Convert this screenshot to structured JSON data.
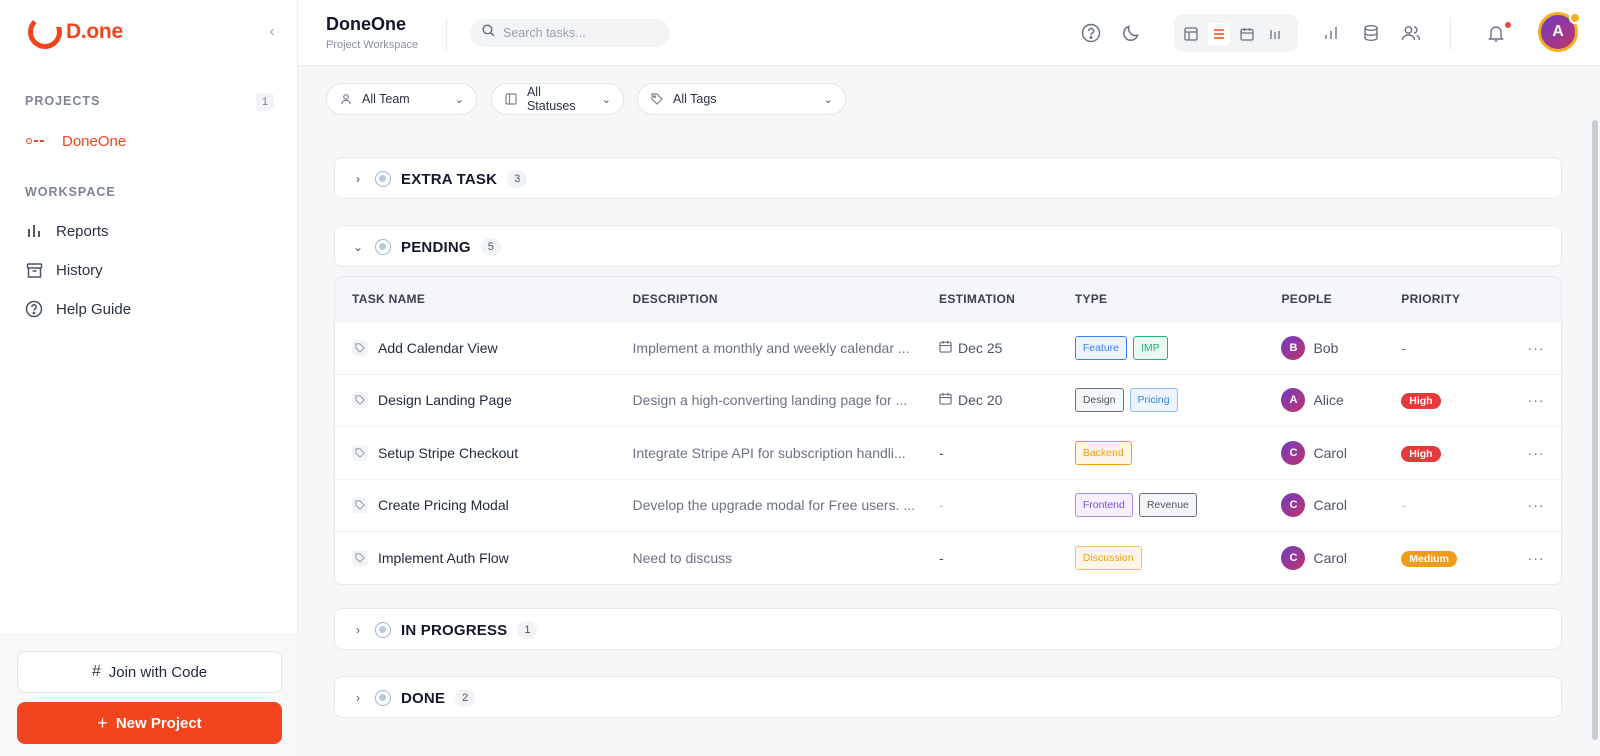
{
  "sidebar": {
    "brand": "D.one",
    "projects_label": "PROJECTS",
    "projects_count": "1",
    "project_name": "DoneOne",
    "workspace_label": "WORKSPACE",
    "nav": [
      {
        "label": "Reports",
        "icon": "bar-chart-icon"
      },
      {
        "label": "History",
        "icon": "archive-icon"
      },
      {
        "label": "Help Guide",
        "icon": "help-circle-icon"
      }
    ],
    "join_label": "Join with Code",
    "new_label": "New Project"
  },
  "header": {
    "title": "DoneOne",
    "subtitle": "Project Workspace",
    "search_placeholder": "Search tasks...",
    "avatar_initial": "A"
  },
  "filters": [
    {
      "label": "All Team",
      "icon": "user-icon"
    },
    {
      "label": "All Statuses",
      "icon": "columns-icon"
    },
    {
      "label": "All Tags",
      "icon": "tag-icon"
    }
  ],
  "groups": {
    "extra": {
      "name": "EXTRA TASK",
      "count": "3"
    },
    "pending": {
      "name": "PENDING",
      "count": "5"
    },
    "in_progress": {
      "name": "IN PROGRESS",
      "count": "1"
    },
    "done": {
      "name": "DONE",
      "count": "2"
    }
  },
  "table": {
    "headers": [
      "TASK NAME",
      "DESCRIPTION",
      "ESTIMATION",
      "TYPE",
      "PEOPLE",
      "PRIORITY"
    ],
    "rows": [
      {
        "name": "Add Calendar View",
        "desc": "Implement a monthly and weekly calendar ...",
        "est": "Dec 25",
        "tags": [
          "Feature",
          "IMP"
        ],
        "person": "Bob",
        "initial": "B",
        "priority": "-"
      },
      {
        "name": "Design Landing Page",
        "desc": "Design a high-converting landing page for ...",
        "est": "Dec 20",
        "tags": [
          "Design",
          "Pricing"
        ],
        "person": "Alice",
        "initial": "A",
        "priority": "High"
      },
      {
        "name": "Setup Stripe Checkout",
        "desc": "Integrate Stripe API for subscription handli...",
        "est": "-",
        "tags": [
          "Backend"
        ],
        "person": "Carol",
        "initial": "C",
        "priority": "High"
      },
      {
        "name": "Create Pricing Modal",
        "desc": "Develop the upgrade modal for Free users. ...",
        "est": "-",
        "tags": [
          "Frontend",
          "Revenue"
        ],
        "person": "Carol",
        "initial": "C",
        "priority": "-"
      },
      {
        "name": "Implement Auth Flow",
        "desc": "Need to discuss",
        "est": "-",
        "tags": [
          "Discussion"
        ],
        "person": "Carol",
        "initial": "C",
        "priority": "Medium"
      }
    ]
  },
  "colors": {
    "accent": "#f0451d",
    "high": "#e63939",
    "medium": "#f29b16",
    "tag_feature": "#3b82f6",
    "tag_imp": "#22b573",
    "tag_design": "#4b5563",
    "tag_pricing": "#3b82f6",
    "tag_backend": "#f29b16",
    "tag_frontend": "#7c4ddb",
    "tag_revenue": "#4b5563",
    "tag_discussion": "#f29b16"
  }
}
